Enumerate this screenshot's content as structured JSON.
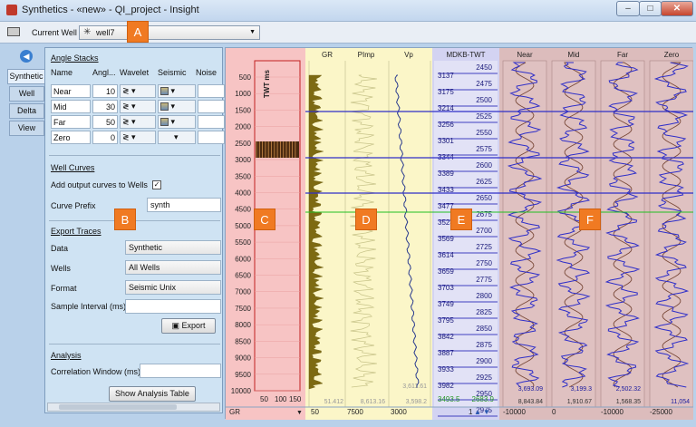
{
  "window": {
    "title": "Synthetics - «new» - QI_project - Insight",
    "min_label": "–",
    "max_label": "□",
    "close_label": "✕"
  },
  "toolbar": {
    "current_well_label": "Current Well",
    "current_well_value": "well7"
  },
  "callouts": {
    "a": "A",
    "b": "B",
    "c": "C",
    "d": "D",
    "e": "E",
    "f": "F"
  },
  "side_tabs": [
    "Synthetic",
    "Well",
    "Delta",
    "View"
  ],
  "angle_stacks": {
    "title": "Angle Stacks",
    "headers": {
      "name": "Name",
      "angle": "Angl...",
      "wavelet": "Wavelet",
      "seismic": "Seismic",
      "noise": "Noise"
    },
    "rows": [
      {
        "name": "Near",
        "angle": "10"
      },
      {
        "name": "Mid",
        "angle": "30"
      },
      {
        "name": "Far",
        "angle": "50"
      },
      {
        "name": "Zero",
        "angle": "0"
      }
    ]
  },
  "well_curves": {
    "title": "Well Curves",
    "add_output_label": "Add output curves to Wells",
    "add_output_checked": true,
    "curve_prefix_label": "Curve Prefix",
    "curve_prefix_value": "synth"
  },
  "export_traces": {
    "title": "Export Traces",
    "data_label": "Data",
    "data_value": "Synthetic",
    "wells_label": "Wells",
    "wells_value": "All Wells",
    "format_label": "Format",
    "format_value": "Seismic Unix",
    "sample_interval_label": "Sample Interval (ms)",
    "sample_interval_value": "",
    "export_button": "Export"
  },
  "analysis": {
    "title": "Analysis",
    "correlation_label": "Correlation Window (ms)",
    "correlation_value": "",
    "show_table_button": "Show Analysis Table"
  },
  "plot": {
    "time_axis_label": "TWT ms",
    "time_ticks": [
      "500",
      "1000",
      "1500",
      "2000",
      "2500",
      "3000",
      "3500",
      "4000",
      "4500",
      "5000",
      "5500",
      "6000",
      "6500",
      "7000",
      "7500",
      "8000",
      "8500",
      "9000",
      "9500",
      "10000"
    ],
    "gr_ticks": [
      "50",
      "100",
      "150"
    ],
    "gr_selector": "GR",
    "log_headers": [
      "GR",
      "PImp",
      "Vp"
    ],
    "log_bottom_values": [
      "51.412",
      "8,613.16",
      "3,598.2"
    ],
    "log_top_values": [
      "",
      "",
      "3,611.61"
    ],
    "log_scale_labels": [
      "50",
      "7500",
      "3000"
    ],
    "mdkb_header": "MDKB-TWT",
    "mdkb_left": [
      "3137",
      "3175",
      "3214",
      "3256",
      "3301",
      "3344",
      "3389",
      "3433",
      "3477",
      "3523",
      "3569",
      "3614",
      "3659",
      "3703",
      "3749",
      "3795",
      "3842",
      "3887",
      "3933",
      "3982",
      ""
    ],
    "mdkb_right": [
      "2450",
      "2475",
      "2500",
      "2525",
      "2550",
      "2575",
      "2600",
      "2625",
      "2650",
      "2675",
      "2700",
      "2725",
      "2750",
      "2775",
      "2800",
      "2825",
      "2850",
      "2875",
      "2900",
      "2925",
      "2950",
      "2975"
    ],
    "mdkb_bottom_left": "3493.5",
    "mdkb_bottom_right": "2683.9",
    "mdkb_nav": "1",
    "stack_headers": [
      "Near",
      "Mid",
      "Far",
      "Zero"
    ],
    "stack_val1": [
      "3,693.09",
      "3,199.3",
      "2,502.32",
      ""
    ],
    "stack_val2": [
      "8,843.84",
      "1,910.67",
      "1,568.35",
      "11,054"
    ],
    "stack_scale": [
      "-10000",
      "0",
      "-10000",
      "-25000"
    ],
    "colors": {
      "gr_bg": "#f7c4c4",
      "log_bg": "#fbf6c8",
      "mdkb_bg": "#d3d3f2",
      "stack_bg": "#dcbcbc",
      "trace_blue": "#2f2fc8",
      "trace_brown": "#7a4a3a",
      "green_line": "#22c022"
    }
  }
}
